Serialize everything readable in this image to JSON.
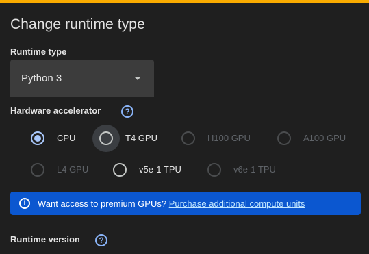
{
  "dialog": {
    "title": "Change runtime type"
  },
  "runtime_type": {
    "label": "Runtime type",
    "selected": "Python 3"
  },
  "hardware_accelerator": {
    "label": "Hardware accelerator",
    "options": [
      {
        "label": "CPU",
        "state": "checked"
      },
      {
        "label": "T4 GPU",
        "state": "enabled"
      },
      {
        "label": "H100 GPU",
        "state": "disabled"
      },
      {
        "label": "A100 GPU",
        "state": "disabled"
      },
      {
        "label": "L4 GPU",
        "state": "disabled"
      },
      {
        "label": "v5e-1 TPU",
        "state": "enabled"
      },
      {
        "label": "v6e-1 TPU",
        "state": "disabled"
      }
    ]
  },
  "banner": {
    "icon": "info-icon",
    "text": "Want access to premium GPUs?",
    "link": "Purchase additional compute units"
  },
  "runtime_version": {
    "label": "Runtime version"
  },
  "colors": {
    "accent_bar": "#f9ab00",
    "background": "#1f1f1f",
    "banner": "#0b57d0",
    "radio_checked": "#a8c7fa",
    "help_icon": "#8ab4f8"
  }
}
